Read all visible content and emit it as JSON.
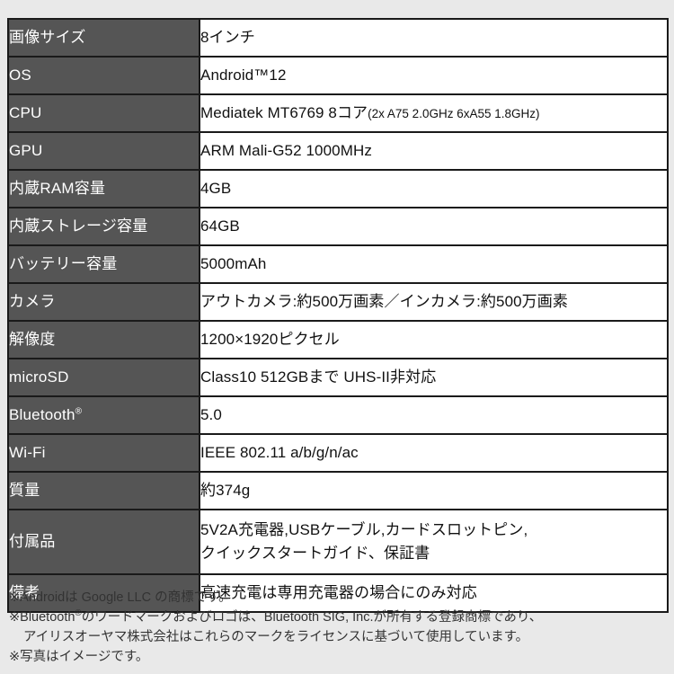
{
  "table": {
    "rows": [
      {
        "label": "画像サイズ",
        "value": "8インチ"
      },
      {
        "label": "OS",
        "value": "Android™12"
      },
      {
        "label": "CPU",
        "value": "Mediatek  MT6769 8コア",
        "value_small": "(2x A75 2.0GHz 6xA55 1.8GHz)"
      },
      {
        "label": "GPU",
        "value": "ARM Mali-G52 1000MHz"
      },
      {
        "label": "内蔵RAM容量",
        "value": "4GB"
      },
      {
        "label": "内蔵ストレージ容量",
        "value": "64GB"
      },
      {
        "label": "バッテリー容量",
        "value": "5000mAh"
      },
      {
        "label": "カメラ",
        "value": "アウトカメラ:約500万画素／インカメラ:約500万画素"
      },
      {
        "label": "解像度",
        "value": "1200×1920ピクセル"
      },
      {
        "label": "microSD",
        "value": "Class10 512GBまで UHS-II非対応"
      },
      {
        "label": "Bluetooth",
        "label_sup": "®",
        "value": "5.0"
      },
      {
        "label": "Wi-Fi",
        "value": "IEEE 802.11 a/b/g/n/ac"
      },
      {
        "label": "質量",
        "value": "約374g"
      },
      {
        "label": "付属品",
        "value_line1": "5V2A充電器,USBケーブル,カードスロットピン,",
        "value_line2": "クイックスタートガイド、保証書"
      },
      {
        "label": "備考",
        "value": "高速充電は専用充電器の場合にのみ対応"
      }
    ]
  },
  "footnotes": {
    "line1": "※Androidは Google LLC の商標です。",
    "line2_a": "※Bluetooth",
    "line2_sup": "®",
    "line2_b": "のワードマークおよびロゴは、Bluetooth SIG, Inc.が所有する登録商標であり、",
    "line3": "アイリスオーヤマ株式会社はこれらのマークをライセンスに基づいて使用しています。",
    "line4": "※写真はイメージです。"
  },
  "colors": {
    "label_bg": "#555555",
    "value_bg": "#ffffff",
    "border": "#1a1a1a",
    "page_bg": "#e9e9e9",
    "footnote_text": "#333333"
  }
}
